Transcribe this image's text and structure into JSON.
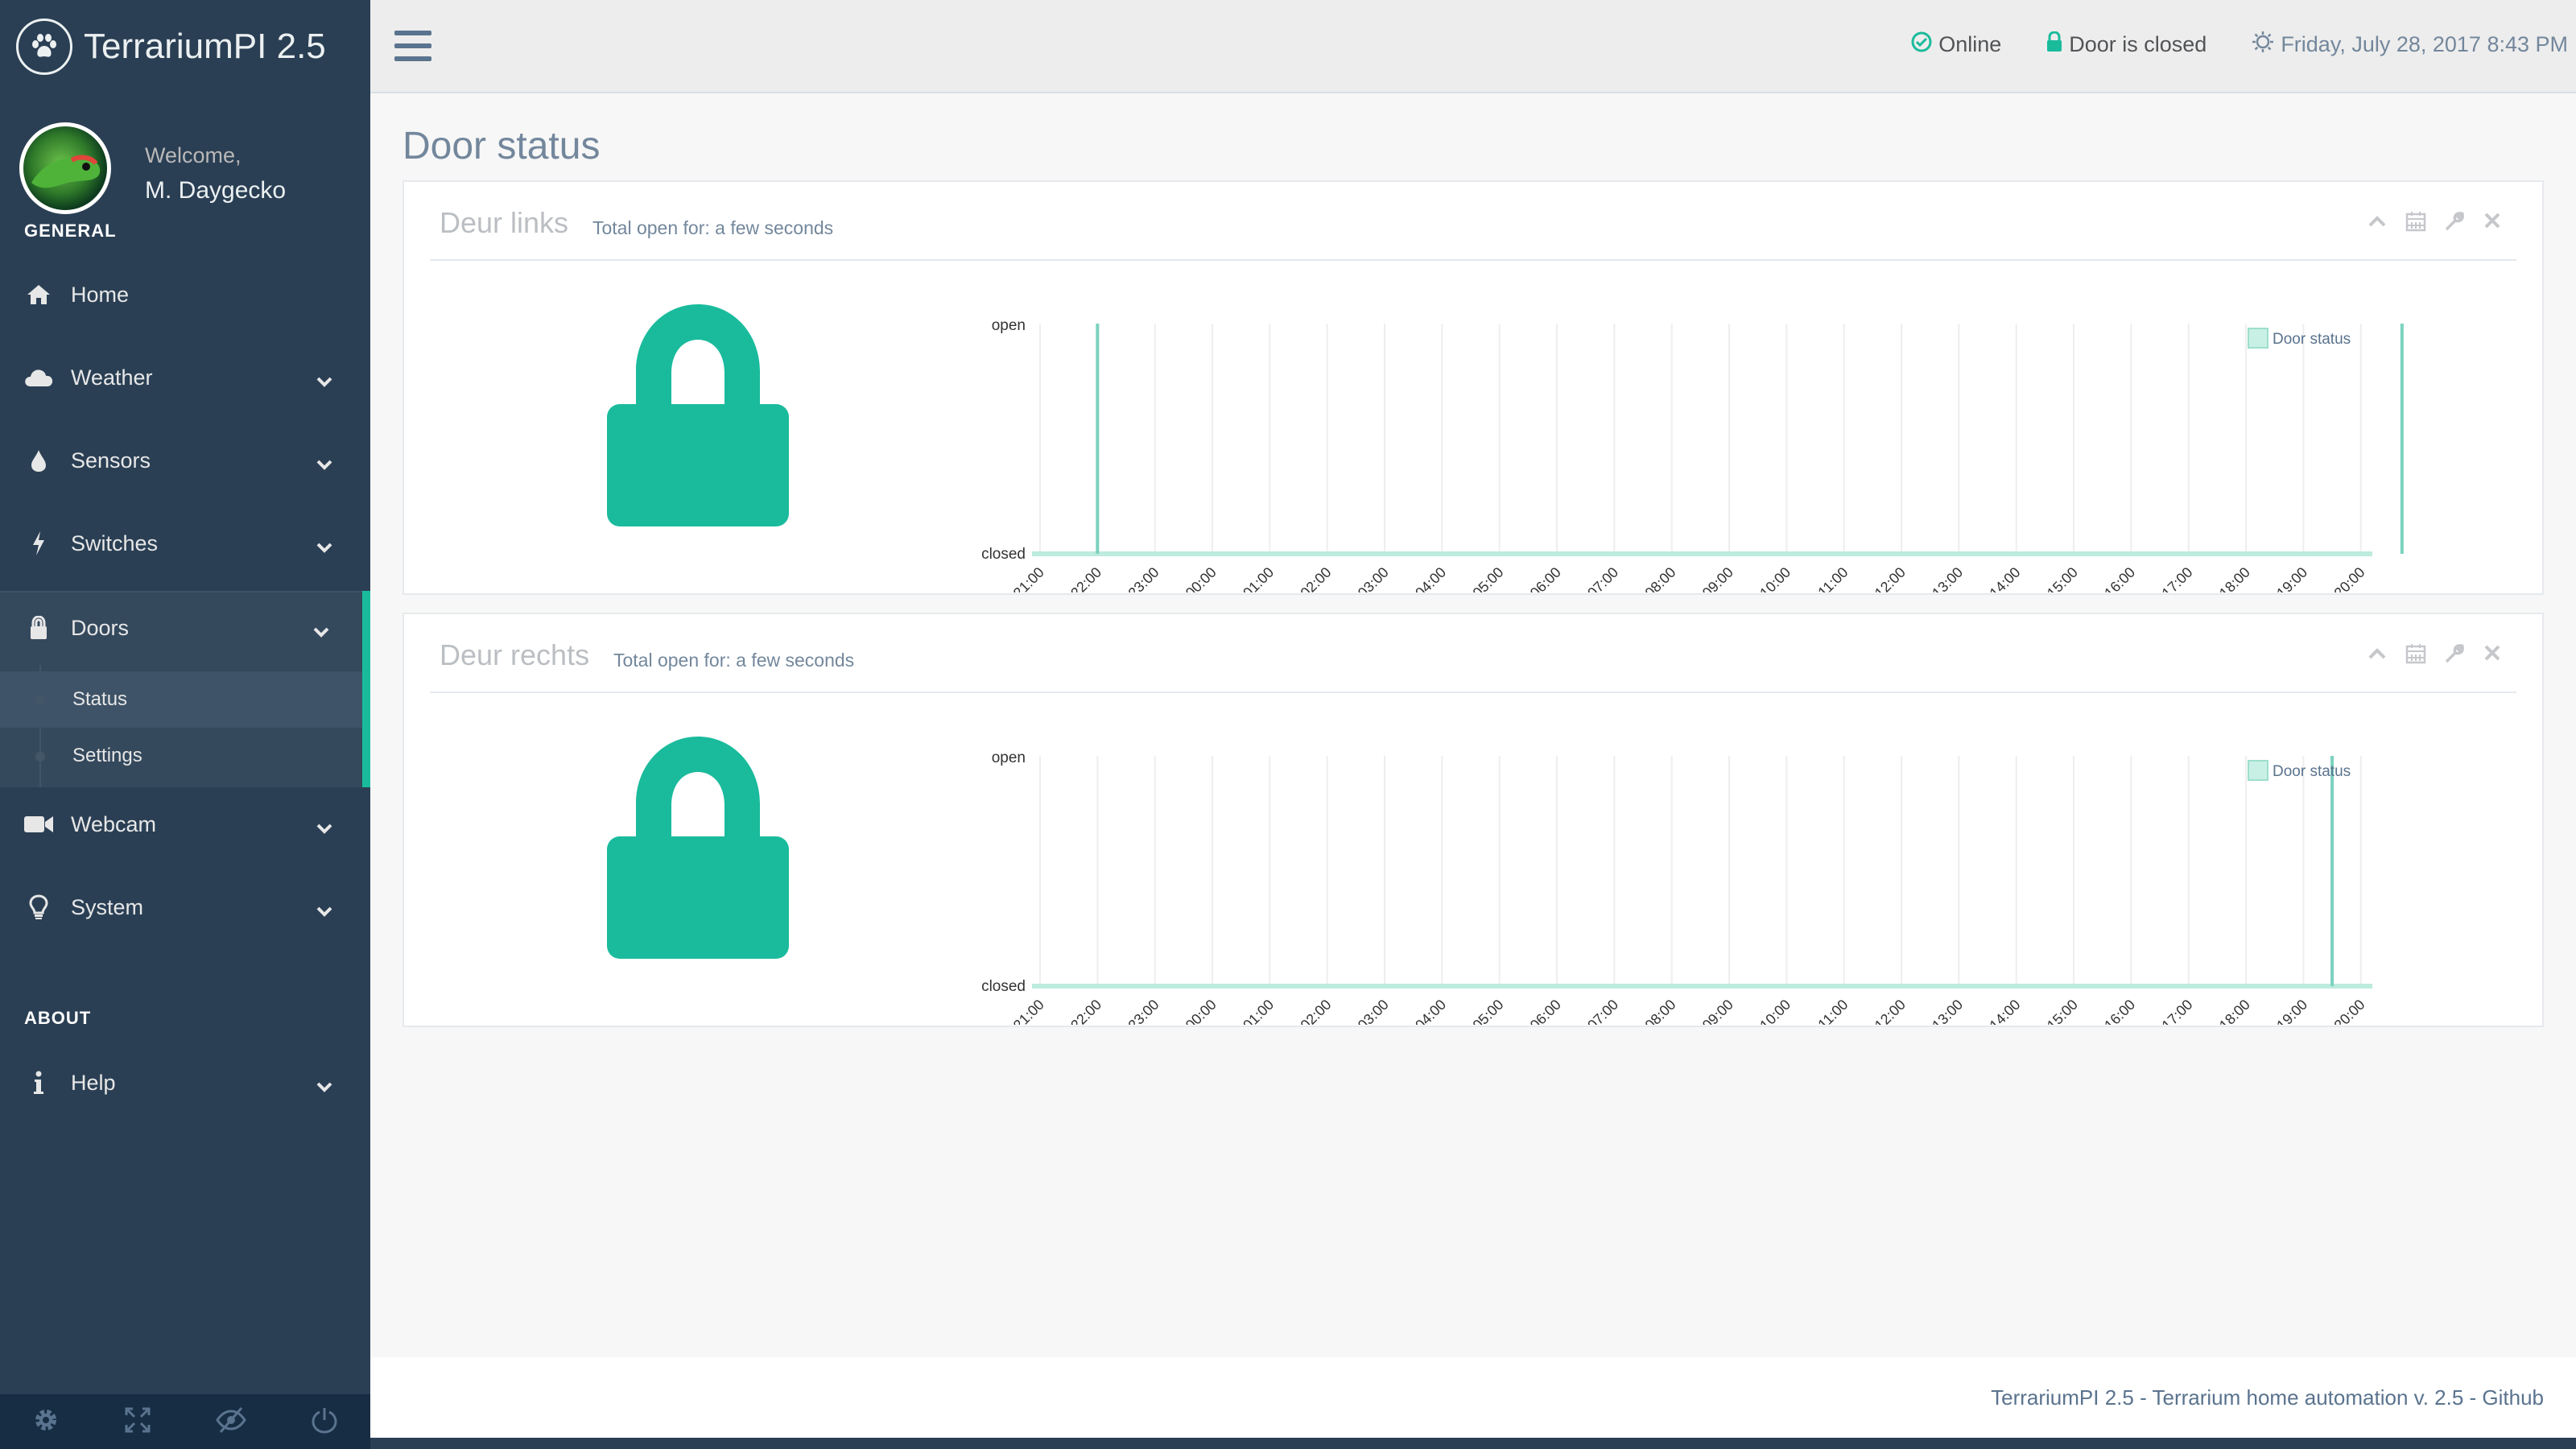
{
  "app": {
    "title": "TerrariumPI 2.5"
  },
  "profile": {
    "welcome": "Welcome,",
    "name": "M. Daygecko"
  },
  "sidebar": {
    "general_label": "GENERAL",
    "about_label": "ABOUT",
    "items": [
      {
        "label": "Home",
        "icon": "home-icon"
      },
      {
        "label": "Weather",
        "icon": "cloud-icon"
      },
      {
        "label": "Sensors",
        "icon": "tint-icon"
      },
      {
        "label": "Switches",
        "icon": "bolt-icon"
      },
      {
        "label": "Doors",
        "icon": "lock-icon"
      },
      {
        "label": "Webcam",
        "icon": "video-camera-icon"
      },
      {
        "label": "System",
        "icon": "lightbulb-icon"
      }
    ],
    "doors_submenu": [
      {
        "label": "Status"
      },
      {
        "label": "Settings"
      }
    ],
    "about_items": [
      {
        "label": "Help",
        "icon": "info-icon"
      }
    ],
    "footer_icons": [
      "gear-icon",
      "fullscreen-icon",
      "eye-slash-icon",
      "power-icon"
    ]
  },
  "topnav": {
    "online": "Online",
    "door_status": "Door is closed",
    "datetime": "Friday, July 28, 2017 8:43 PM"
  },
  "page": {
    "title": "Door status"
  },
  "panels": [
    {
      "title": "Deur links",
      "subtitle": "Total open for: a few seconds"
    },
    {
      "title": "Deur rechts",
      "subtitle": "Total open for: a few seconds"
    }
  ],
  "colors": {
    "accent": "#1ABB9C",
    "sidebar": "#2A3F54"
  },
  "chart_data": [
    {
      "type": "line",
      "title": "Deur links",
      "legend": "top-right",
      "series": [
        {
          "name": "Door status",
          "values": [
            [
              22.0,
              1
            ],
            [
              20.5,
              1
            ]
          ]
        }
      ],
      "categories": [
        "21:00",
        "22:00",
        "23:00",
        "00:00",
        "01:00",
        "02:00",
        "03:00",
        "04:00",
        "05:00",
        "06:00",
        "07:00",
        "08:00",
        "09:00",
        "10:00",
        "11:00",
        "12:00",
        "13:00",
        "14:00",
        "15:00",
        "16:00",
        "17:00",
        "18:00",
        "19:00",
        "20:00"
      ],
      "y_labels": [
        "open",
        "closed"
      ],
      "open_marks": [
        "22:00",
        "20:43"
      ]
    },
    {
      "type": "line",
      "title": "Deur rechts",
      "legend": "top-right",
      "series": [
        {
          "name": "Door status"
        }
      ],
      "categories": [
        "21:00",
        "22:00",
        "23:00",
        "00:00",
        "01:00",
        "02:00",
        "03:00",
        "04:00",
        "05:00",
        "06:00",
        "07:00",
        "08:00",
        "09:00",
        "10:00",
        "11:00",
        "12:00",
        "13:00",
        "14:00",
        "15:00",
        "16:00",
        "17:00",
        "18:00",
        "19:00",
        "20:00"
      ],
      "y_labels": [
        "open",
        "closed"
      ],
      "open_marks": [
        "19:30"
      ]
    }
  ],
  "footer": {
    "text": "TerrariumPI 2.5 - Terrarium home automation v. 2.5 - Github"
  }
}
